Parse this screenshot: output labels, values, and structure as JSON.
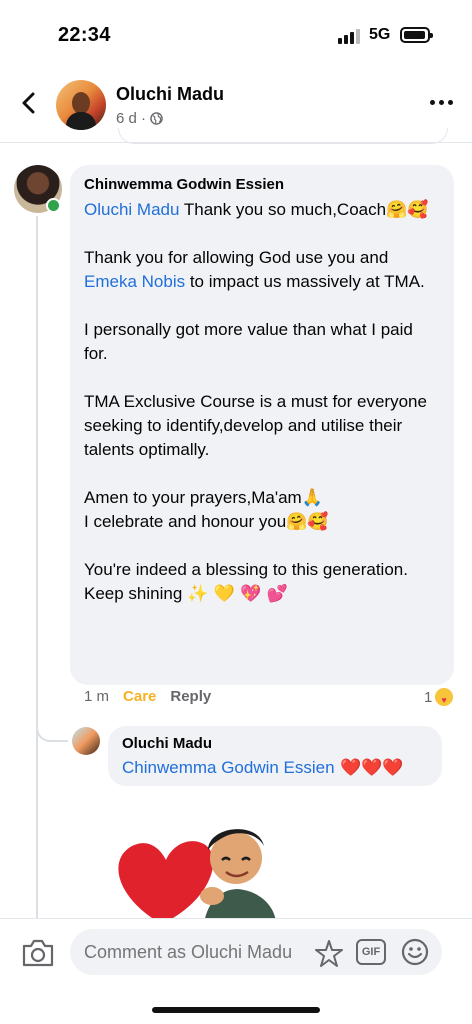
{
  "status_bar": {
    "time": "22:34",
    "network": "5G",
    "battery_level": 0.8
  },
  "header": {
    "name": "Oluchi Madu",
    "meta": "6 d ·",
    "icons": [
      "back-arrow-icon",
      "globe-icon",
      "more-icon"
    ]
  },
  "comment": {
    "author": "Chinwemma Godwin Essien",
    "p1_mention": "Oluchi Madu",
    "p1_text": " Thank you so much,Coach",
    "p1_emoji": "🤗🥰",
    "p2_a": "Thank you for allowing God use you and ",
    "p2_mention": "Emeka Nobis",
    "p2_b": " to impact us massively at TMA.",
    "p3": "I personally got more value than what I paid for.",
    "p4": "TMA Exclusive Course is a must for everyone seeking to identify,develop and utilise their talents optimally.",
    "p5_line1": "Amen to your prayers,Ma'am",
    "p5_line1_emoji": "🙏",
    "p5_line2": "I celebrate and honour you",
    "p5_line2_emoji": "🤗🥰",
    "p6_line1": "You're  indeed a blessing to this generation.",
    "p6_line2": "Keep shining ",
    "p6_line2_emoji": "✨ 💛 💖 💕",
    "time": "1 m",
    "reaction_label": "Care",
    "reply_label": "Reply",
    "reaction_count": "1"
  },
  "reply": {
    "author": "Oluchi Madu",
    "mention": "Chinwemma Godwin Essien",
    "emoji": " ❤️❤️❤️"
  },
  "composer": {
    "placeholder": "Comment as Oluchi Madu",
    "gif_label": "GIF"
  }
}
